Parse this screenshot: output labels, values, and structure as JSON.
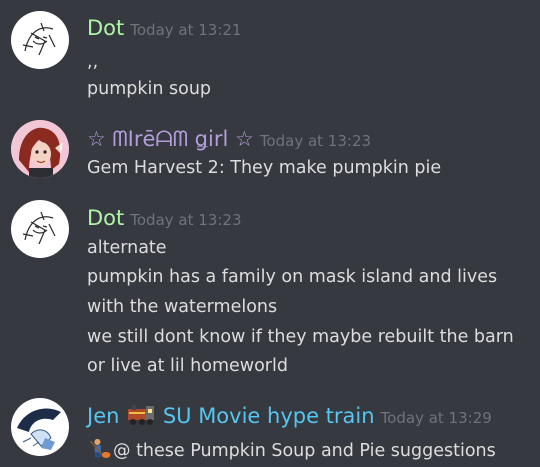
{
  "messages": [
    {
      "author": "Dot",
      "author_color": "#aef5a8",
      "timestamp": "Today at 13:21",
      "avatar_icon": "pearl-sketch-avatar",
      "lines": [
        ",,",
        "pumpkin soup"
      ]
    },
    {
      "author": "☆ ᗰIrēᗩᗰ ǥirl ☆",
      "author_color": "#b39ddb",
      "timestamp": "Today at 13:23",
      "avatar_icon": "red-haired-girl-avatar",
      "lines": [
        "Gem Harvest 2: They make pumpkin pie"
      ]
    },
    {
      "author": "Dot",
      "author_color": "#aef5a8",
      "timestamp": "Today at 13:23",
      "avatar_icon": "pearl-sketch-avatar",
      "lines": [
        "alternate",
        "pumpkin has a family on mask island and lives",
        "with the watermelons",
        "we still dont know if they maybe rebuilt the barn",
        "or live at lil homeworld"
      ]
    },
    {
      "author": "Jen",
      "author_suffix": "SU Movie hype train",
      "author_color": "#55c6f0",
      "author_emoji": "train-icon",
      "timestamp": "Today at 13:29",
      "avatar_icon": "lapis-sketch-avatar",
      "line_emoji": "pumpkin-farmer-emoji",
      "lines": [
        "@ these Pumpkin Soup and Pie suggestions"
      ]
    }
  ]
}
